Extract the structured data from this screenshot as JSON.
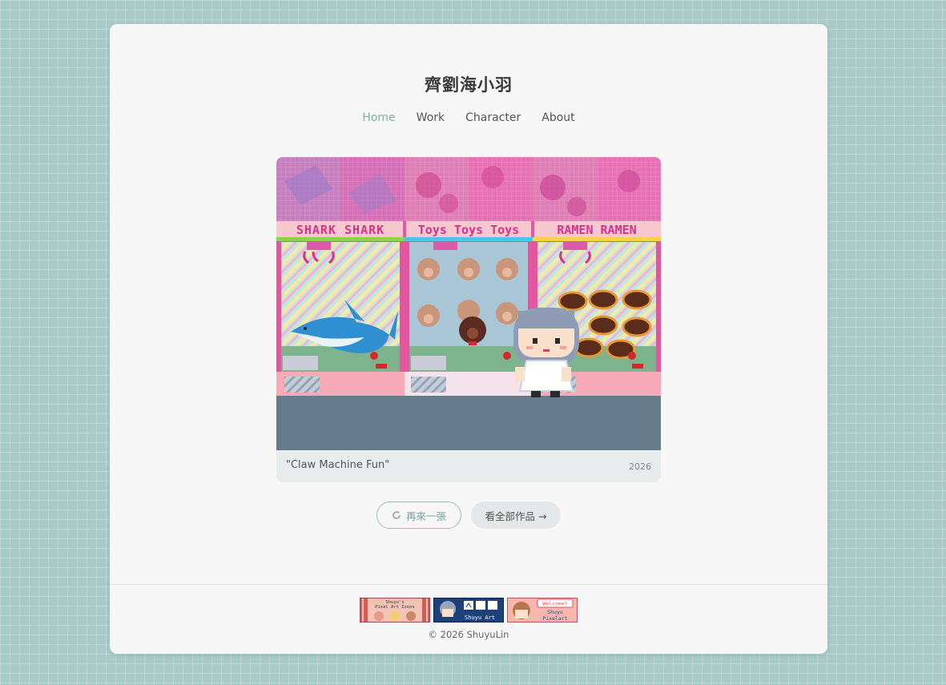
{
  "site": {
    "title": "齊劉海小羽"
  },
  "nav": [
    {
      "label": "Home",
      "active": true
    },
    {
      "label": "Work",
      "active": false
    },
    {
      "label": "Character",
      "active": false
    },
    {
      "label": "About",
      "active": false
    }
  ],
  "artwork": {
    "signs": [
      "SHARK SHARK",
      "Toys Toys Toys",
      "RAMEN RAMEN"
    ],
    "caption": "\"Claw Machine Fun\"",
    "year": "2026"
  },
  "buttons": {
    "refresh_label": "再來一張",
    "all_works_label": "看全部作品 →"
  },
  "banners": [
    {
      "text_line1": "Shuyu's",
      "text_line2": "Pixel Art Icons"
    },
    {
      "text_line1": "Shuyu Art"
    },
    {
      "text_line1": "Welcome!",
      "text_line2": "Shuyu",
      "text_line3": "Pixelart"
    }
  ],
  "footer": {
    "copyright": "© 2026 ShuyuLin"
  },
  "colors": {
    "background": "#a9cbc7",
    "card": "#f7f7f7",
    "accent": "#7fb0a9",
    "machine_pink": "#e4559f",
    "floor": "#667b8a"
  }
}
